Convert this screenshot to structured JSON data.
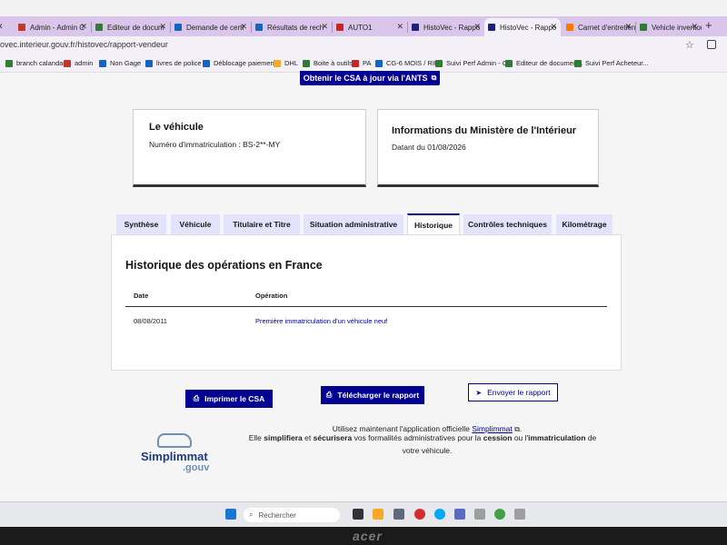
{
  "browser": {
    "tabs": [
      {
        "label": "Admin - Admin C",
        "color": "#c0392b"
      },
      {
        "label": "Editeur de docum",
        "color": "#2e7d32"
      },
      {
        "label": "Demande de certi",
        "color": "#1565c0"
      },
      {
        "label": "Résultats de rech",
        "color": "#1565c0"
      },
      {
        "label": "AUTO1",
        "color": "#c62828"
      },
      {
        "label": "HistoVec - Rappo",
        "color": "#1a237e"
      },
      {
        "label": "HistoVec - Rappo",
        "color": "#1a237e"
      },
      {
        "label": "Carnet d'entretien",
        "color": "#f57c00"
      },
      {
        "label": "Vehicle inventory",
        "color": "#2e7d32"
      }
    ],
    "new_tab": "+",
    "url": "ovec.interieur.gouv.fr/histovec/rapport-vendeur",
    "bookmarks": [
      {
        "label": "branch calandar",
        "color": "#2e7d32"
      },
      {
        "label": "admin",
        "color": "#c0392b"
      },
      {
        "label": "Non Gage",
        "color": "#1565c0"
      },
      {
        "label": "livres de police",
        "color": "#1565c0"
      },
      {
        "label": "Déblocage paiement",
        "color": "#1565c0"
      },
      {
        "label": "DHL",
        "color": "#f9a825"
      },
      {
        "label": "Boite à outils",
        "color": "#2e7d32"
      },
      {
        "label": "PA",
        "color": "#c62828"
      },
      {
        "label": "CG-6 MOIS / RIB",
        "color": "#1565c0"
      },
      {
        "label": "Suivi Perf Admin - C...",
        "color": "#2e7d32"
      },
      {
        "label": "Editeur de documen...",
        "color": "#2e7d32"
      },
      {
        "label": "Suivi Perf Acheteur...",
        "color": "#2e7d32"
      }
    ]
  },
  "page": {
    "csa_top_button": "Obtenir le CSA à jour via l'ANTS",
    "vehicle_card": {
      "title": "Le véhicule",
      "plate_text": "Numéro d'immatriculation : BS-2**-MY"
    },
    "ministry_card": {
      "title": "Informations du Ministère de l'Intérieur",
      "date_text": "Datant du 01/08/2026"
    },
    "tabs": [
      {
        "label": "Synthèse"
      },
      {
        "label": "Véhicule"
      },
      {
        "label": "Titulaire et Titre"
      },
      {
        "label": "Situation administrative"
      },
      {
        "label": "Historique",
        "active": true
      },
      {
        "label": "Contrôles techniques"
      },
      {
        "label": "Kilométrage"
      }
    ],
    "history": {
      "title": "Historique des opérations en France",
      "col_date": "Date",
      "col_operation": "Opération",
      "rows": [
        {
          "date": "08/08/2011",
          "operation": "Première immatriculation d'un véhicule neuf"
        }
      ]
    },
    "buttons": {
      "print": "Imprimer le CSA",
      "download": "Télécharger le rapport",
      "send": "Envoyer le rapport"
    },
    "promo": {
      "line1_prefix": "Utilisez maintenant l'application officielle",
      "app_link": "Simplimmat",
      "line2_a": "Elle",
      "line2_b": "simplifiera",
      "line2_c": "et",
      "line2_d": "sécurisera",
      "line2_e": "vos formalités administratives pour la",
      "line2_f": "cession",
      "line2_g": "ou l'",
      "line2_h": "immatriculation",
      "line2_i": "de",
      "line3": "votre véhicule."
    },
    "logo": {
      "name": "Simplimmat",
      "suffix": ".gouv"
    }
  },
  "taskbar": {
    "search_placeholder": "Rechercher"
  },
  "monitor_brand": "acer"
}
